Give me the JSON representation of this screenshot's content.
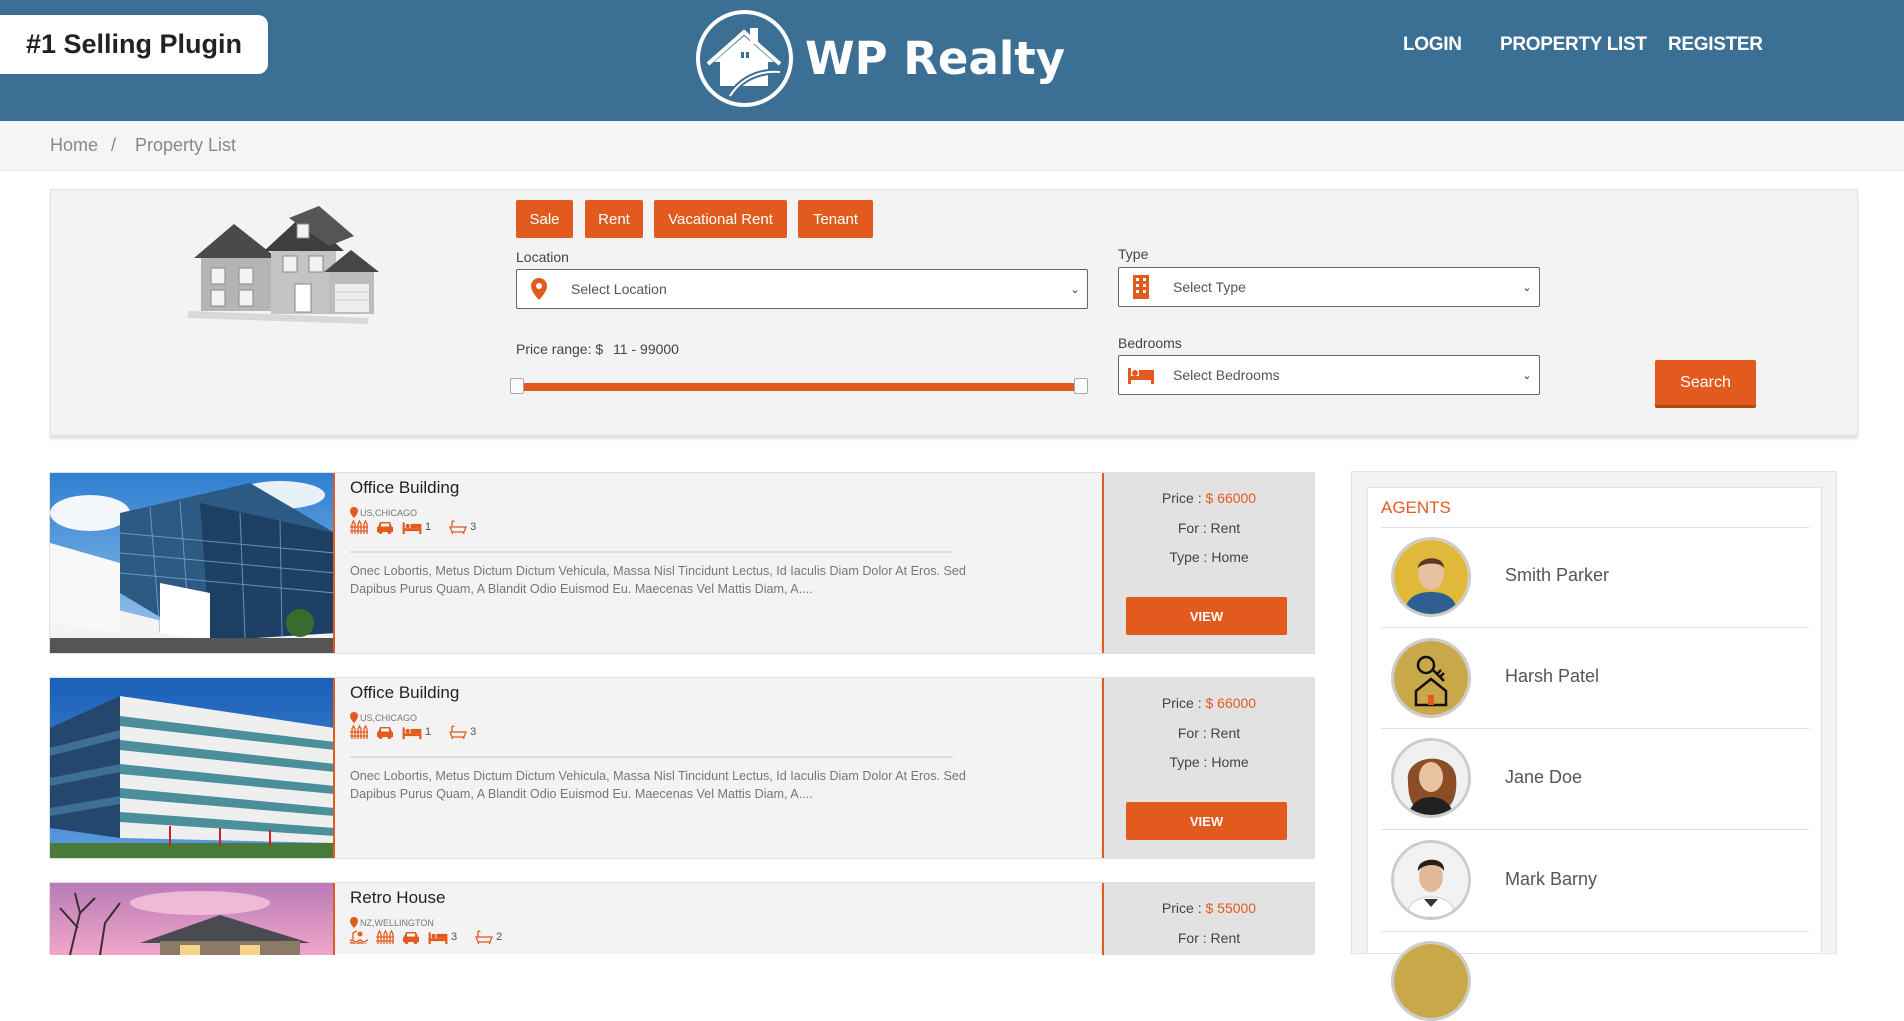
{
  "header": {
    "badge": "#1 Selling Plugin",
    "logo_text": "WP Realty",
    "nav": [
      "LOGIN",
      "PROPERTY LIST",
      "REGISTER"
    ]
  },
  "breadcrumb": {
    "home": "Home",
    "sep": "/",
    "current": "Property List"
  },
  "search": {
    "tabs": [
      "Sale",
      "Rent",
      "Vacational Rent",
      "Tenant"
    ],
    "location_label": "Location",
    "location_placeholder": "Select Location",
    "type_label": "Type",
    "type_placeholder": "Select Type",
    "price_label": "Price range: $",
    "price_value": "11 - 99000",
    "bedrooms_label": "Bedrooms",
    "bedrooms_placeholder": "Select Bedrooms",
    "search_button": "Search"
  },
  "listings": [
    {
      "title": "Office Building",
      "location": "US,CHICAGO",
      "bedrooms": "1",
      "bathrooms": "3",
      "description": "Onec Lobortis, Metus Dictum Dictum Vehicula, Massa Nisl Tincidunt Lectus, Id Iaculis Diam Dolor At Eros. Sed Dapibus Purus Quam, A Blandit Odio Euismod Eu. Maecenas Vel Mattis Diam, A....",
      "price_label": "Price :",
      "price": "$ 66000",
      "for_label": "For : Rent",
      "type_label": "Type : Home",
      "view": "VIEW"
    },
    {
      "title": "Office Building",
      "location": "US,CHICAGO",
      "bedrooms": "1",
      "bathrooms": "3",
      "description": "Onec Lobortis, Metus Dictum Dictum Vehicula, Massa Nisl Tincidunt Lectus, Id Iaculis Diam Dolor At Eros. Sed Dapibus Purus Quam, A Blandit Odio Euismod Eu. Maecenas Vel Mattis Diam, A....",
      "price_label": "Price :",
      "price": "$ 66000",
      "for_label": "For : Rent",
      "type_label": "Type : Home",
      "view": "VIEW"
    },
    {
      "title": "Retro House",
      "location": "NZ,WELLINGTON",
      "bedrooms": "3",
      "bathrooms": "2",
      "price_label": "Price :",
      "price": "$ 55000",
      "for_label": "For : Rent"
    }
  ],
  "agents": {
    "title": "AGENTS",
    "list": [
      "Smith Parker",
      "Harsh Patel",
      "Jane Doe",
      "Mark Barny"
    ]
  },
  "colors": {
    "header": "#3b6f94",
    "accent": "#e35a1f",
    "panel": "#f3f3f3"
  }
}
